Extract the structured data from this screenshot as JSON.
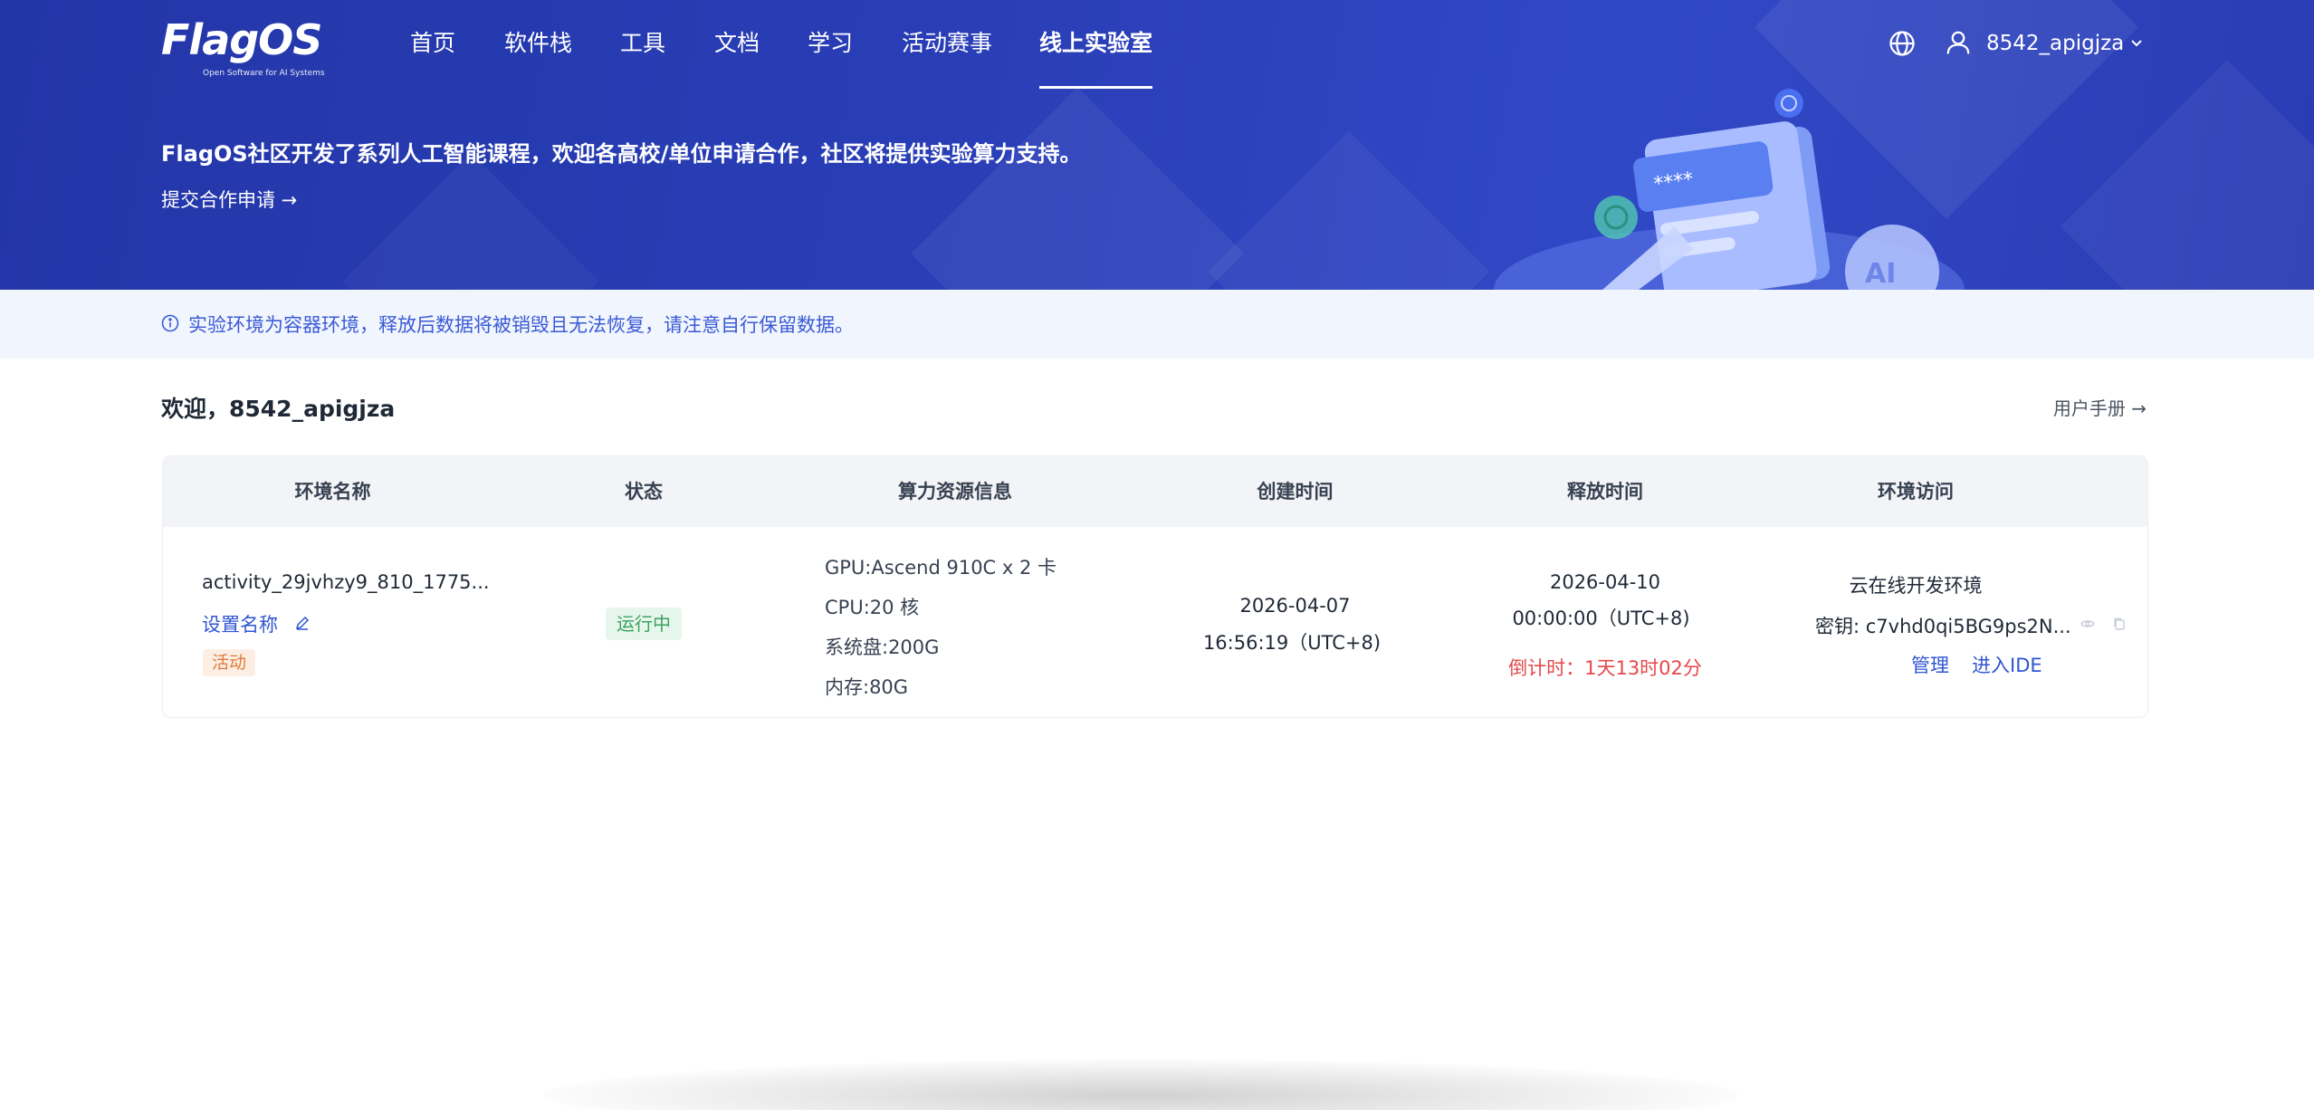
{
  "header": {
    "logo_text": "FlagOS",
    "logo_tagline": "Open Software for AI Systems",
    "nav": [
      {
        "label": "首页"
      },
      {
        "label": "软件栈"
      },
      {
        "label": "工具"
      },
      {
        "label": "文档"
      },
      {
        "label": "学习"
      },
      {
        "label": "活动赛事"
      },
      {
        "label": "线上实验室",
        "active": true
      }
    ],
    "username": "8542_apigjza"
  },
  "banner": {
    "promo_text": "FlagOS社区开发了系列人工智能课程，欢迎各高校/单位申请合作，社区将提供实验算力支持。",
    "apply_link": "提交合作申请 →"
  },
  "notice": {
    "text": "实验环境为容器环境，释放后数据将被销毁且无法恢复，请注意自行保留数据。"
  },
  "welcome": {
    "greeting": "欢迎，8542_apigjza",
    "manual_link": "用户手册 →"
  },
  "table": {
    "headers": [
      "环境名称",
      "状态",
      "算力资源信息",
      "创建时间",
      "释放时间",
      "环境访问"
    ],
    "rows": [
      {
        "env_name": "activity_29jvhzy9_810_1775...",
        "rename_link": "设置名称",
        "tag": "活动",
        "status": "运行中",
        "resources": {
          "gpu": "GPU:Ascend 910C x 2 卡",
          "cpu": "CPU:20 核",
          "disk": "系统盘:200G",
          "memory": "内存:80G"
        },
        "created_date": "2026-04-07",
        "created_time": "16:56:19（UTC+8)",
        "release_date": "2026-04-10",
        "release_time": "00:00:00（UTC+8)",
        "countdown": "倒计时：1天13时02分",
        "access_title": "云在线开发环境",
        "secret": "密钥: c7vhd0qi5BG9ps2N...",
        "manage_link": "管理",
        "ide_link": "进入IDE"
      }
    ]
  },
  "colors": {
    "banner_bg": "#2a3fb8",
    "link": "#2f55d4",
    "notice_text": "#3b5bd6",
    "running": "#3aa35f",
    "countdown": "#e5484d",
    "activity_tag": "#e07a3a"
  }
}
